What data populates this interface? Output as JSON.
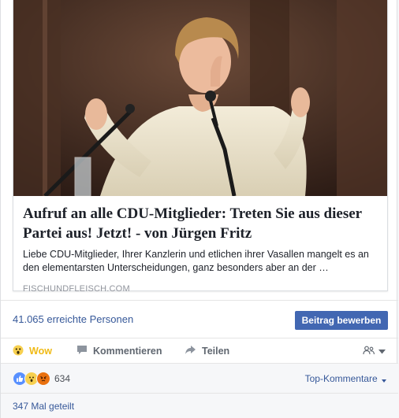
{
  "link_card": {
    "title": "Aufruf an alle CDU-Mitglieder: Treten Sie aus dieser Partei aus! Jetzt! - von Jürgen Fritz",
    "description": "Liebe CDU-Mitglieder, Ihrer Kanzlerin und etlichen ihrer Vasallen mangelt es an den elementarsten Unterscheidungen, ganz besonders aber an der …",
    "domain": "FISCHUNDFLEISCH.COM"
  },
  "insights": {
    "reach_text": "41.065 erreichte Personen",
    "boost_label": "Beitrag bewerben"
  },
  "actions": {
    "wow_label": "Wow",
    "comment_label": "Kommentieren",
    "share_label": "Teilen"
  },
  "reactions": {
    "count": "634",
    "icons": [
      "like-icon",
      "wow-icon",
      "angry-icon"
    ],
    "top_comments_label": "Top-Kommentare"
  },
  "shares": {
    "text": "347 Mal geteilt"
  },
  "colors": {
    "link_blue": "#365899",
    "button_blue": "#4267b2",
    "wow_yellow": "#f0ba15",
    "text_gray": "#606770"
  }
}
